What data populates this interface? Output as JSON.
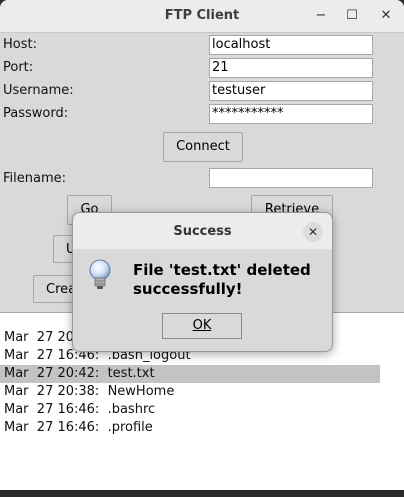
{
  "window": {
    "title": "FTP Client",
    "minimize_glyph": "−",
    "maximize_glyph": "☐",
    "close_glyph": "✕"
  },
  "form": {
    "host_label": "Host:",
    "host_value": "localhost",
    "port_label": "Port:",
    "port_value": "21",
    "username_label": "Username:",
    "username_value": "testuser",
    "password_label": "Password:",
    "password_value": "***********",
    "connect_label": "Connect",
    "filename_label": "Filename:",
    "filename_value": ""
  },
  "buttons": {
    "go": "Go",
    "retrieve": "Retrieve",
    "upload_partial": "U",
    "create_partial": "Crea"
  },
  "file_list": [
    {
      "text": "Mar  27 20"
    },
    {
      "text": "Mar  27 16:46:  .bash_logout"
    },
    {
      "text": "Mar  27 20:42:  test.txt",
      "selected": true
    },
    {
      "text": "Mar  27 20:38:  NewHome"
    },
    {
      "text": "Mar  27 16:46:  .bashrc"
    },
    {
      "text": "Mar  27 16:46:  .profile"
    }
  ],
  "dialog": {
    "title": "Success",
    "close_glyph": "✕",
    "message": "File 'test.txt' deleted successfully!",
    "ok_label": "OK",
    "icon": "info-lightbulb-icon"
  },
  "colors": {
    "window_bg": "#d9d9d9",
    "titlebar_bg": "#ececec",
    "selected_row": "#c3c3c3"
  }
}
